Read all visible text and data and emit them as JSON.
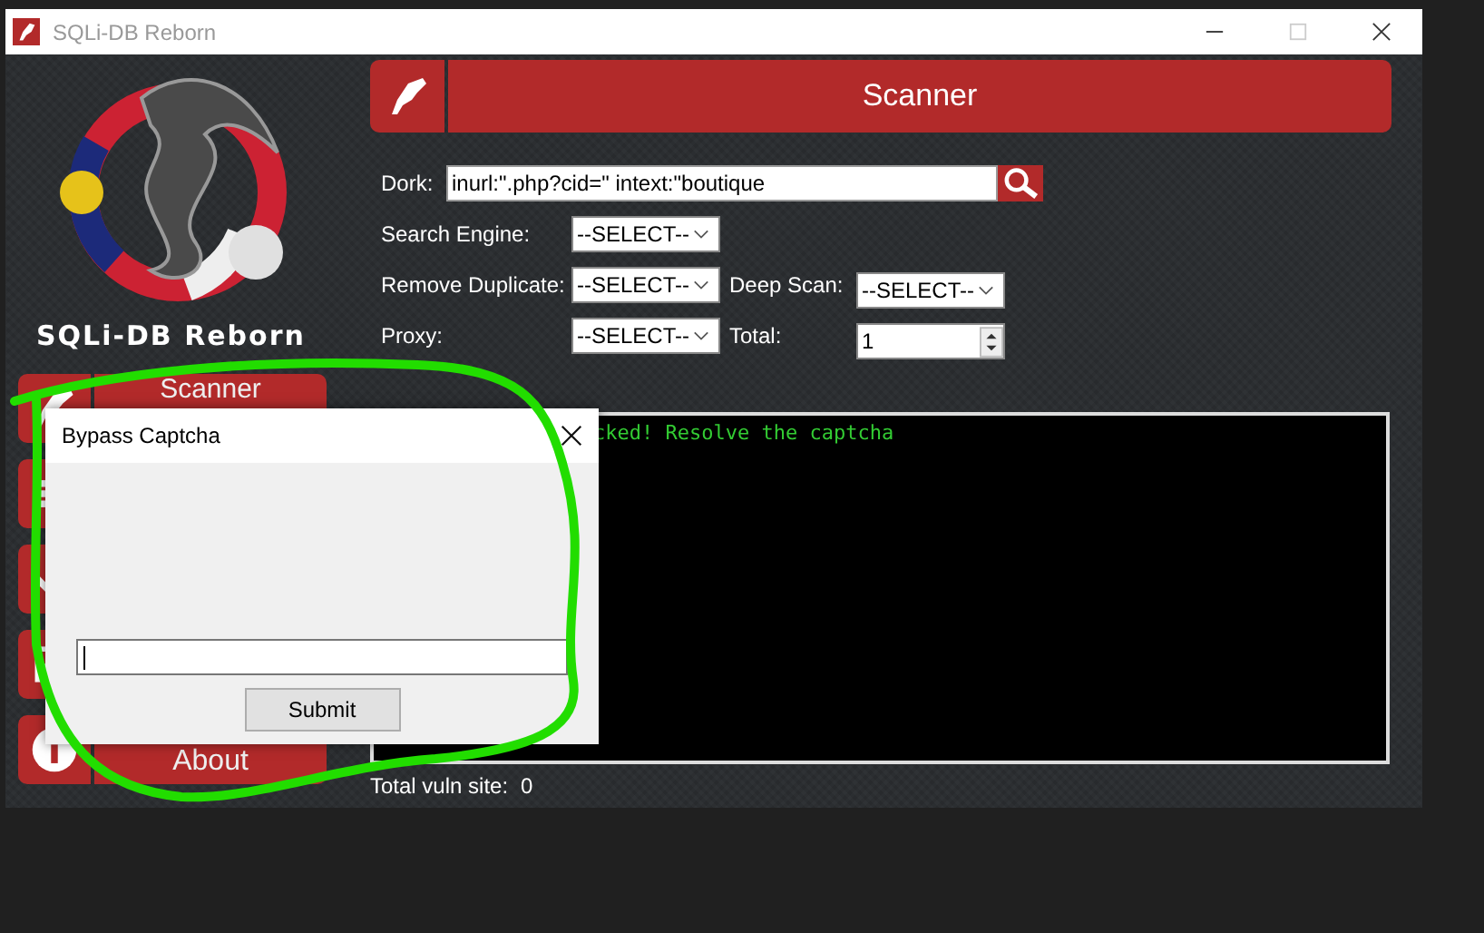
{
  "window": {
    "title": "SQLi-DB Reborn",
    "controls": [
      {
        "kind": "minimize",
        "disabled": false
      },
      {
        "kind": "maximize",
        "disabled": true
      },
      {
        "kind": "close",
        "disabled": false
      }
    ]
  },
  "sidebar": {
    "brand": "SQLi-DB Reborn",
    "items": [
      {
        "kind": "scanner",
        "label": "Scanner"
      },
      {
        "kind": "list"
      },
      {
        "kind": "check"
      },
      {
        "kind": "checklist"
      },
      {
        "kind": "about",
        "label": "About"
      }
    ]
  },
  "header": {
    "title": "Scanner"
  },
  "dork": {
    "label": "Dork:",
    "value": "inurl:\".php?cid=\" intext:\"boutique"
  },
  "options": [
    {
      "label": "Search Engine:",
      "kind": "select",
      "value": "--SELECT--"
    },
    {
      "label": "Remove Duplicate:",
      "kind": "select",
      "value": "--SELECT--",
      "extra": {
        "label": "Deep Scan:",
        "kind": "select",
        "value": "--SELECT--"
      }
    },
    {
      "label": "Proxy:",
      "kind": "select",
      "value": "--SELECT--",
      "extra": {
        "label": "Total:",
        "kind": "number",
        "value": "1"
      }
    }
  ],
  "console": {
    "lines": [
      "cked! Resolve the captcha"
    ]
  },
  "total": {
    "label": "Total vuln site:",
    "value": "0"
  },
  "dialog": {
    "title": "Bypass Captcha",
    "input": {
      "focused": true
    },
    "button": "Submit"
  },
  "annotation": {
    "kind": "scribble"
  }
}
